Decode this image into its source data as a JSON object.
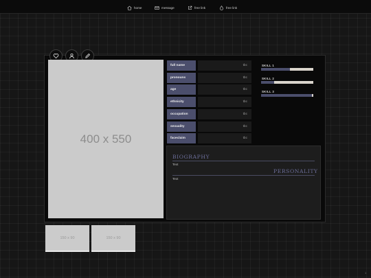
{
  "nav": [
    {
      "icon": "home-icon",
      "label": "home"
    },
    {
      "icon": "mail-icon",
      "label": "message"
    },
    {
      "icon": "link-icon",
      "label": "free link"
    },
    {
      "icon": "drop-icon",
      "label": "free link"
    }
  ],
  "actions": [
    "heart-icon",
    "user-icon",
    "pencil-icon"
  ],
  "main_image": {
    "text": "400 x 550"
  },
  "fields": [
    {
      "label": "full name",
      "value": "tbc"
    },
    {
      "label": "pronouns",
      "value": "tbc"
    },
    {
      "label": "age",
      "value": "tbc"
    },
    {
      "label": "ethnicity",
      "value": "tbc"
    },
    {
      "label": "occupation",
      "value": "tbc"
    },
    {
      "label": "sexuality",
      "value": "tbc"
    },
    {
      "label": "faceclaim",
      "value": "tbc"
    }
  ],
  "skills": [
    {
      "label": "SKILL 1",
      "level": 0.55
    },
    {
      "label": "SKILL 2",
      "level": 0.25
    },
    {
      "label": "SKILL 3",
      "level": 0.97
    }
  ],
  "biography": {
    "title": "BIOGRAPHY",
    "text": "Text"
  },
  "personality": {
    "title": "PERSONALITY",
    "text": "Text"
  },
  "thumbnails": [
    {
      "text": "150 x 90"
    },
    {
      "text": "150 x 90"
    }
  ],
  "corner_mark": "1",
  "colors": {
    "accent": "#4b4e6c",
    "heading": "#6c6e9a",
    "bar_track": "#d9d4cc"
  }
}
